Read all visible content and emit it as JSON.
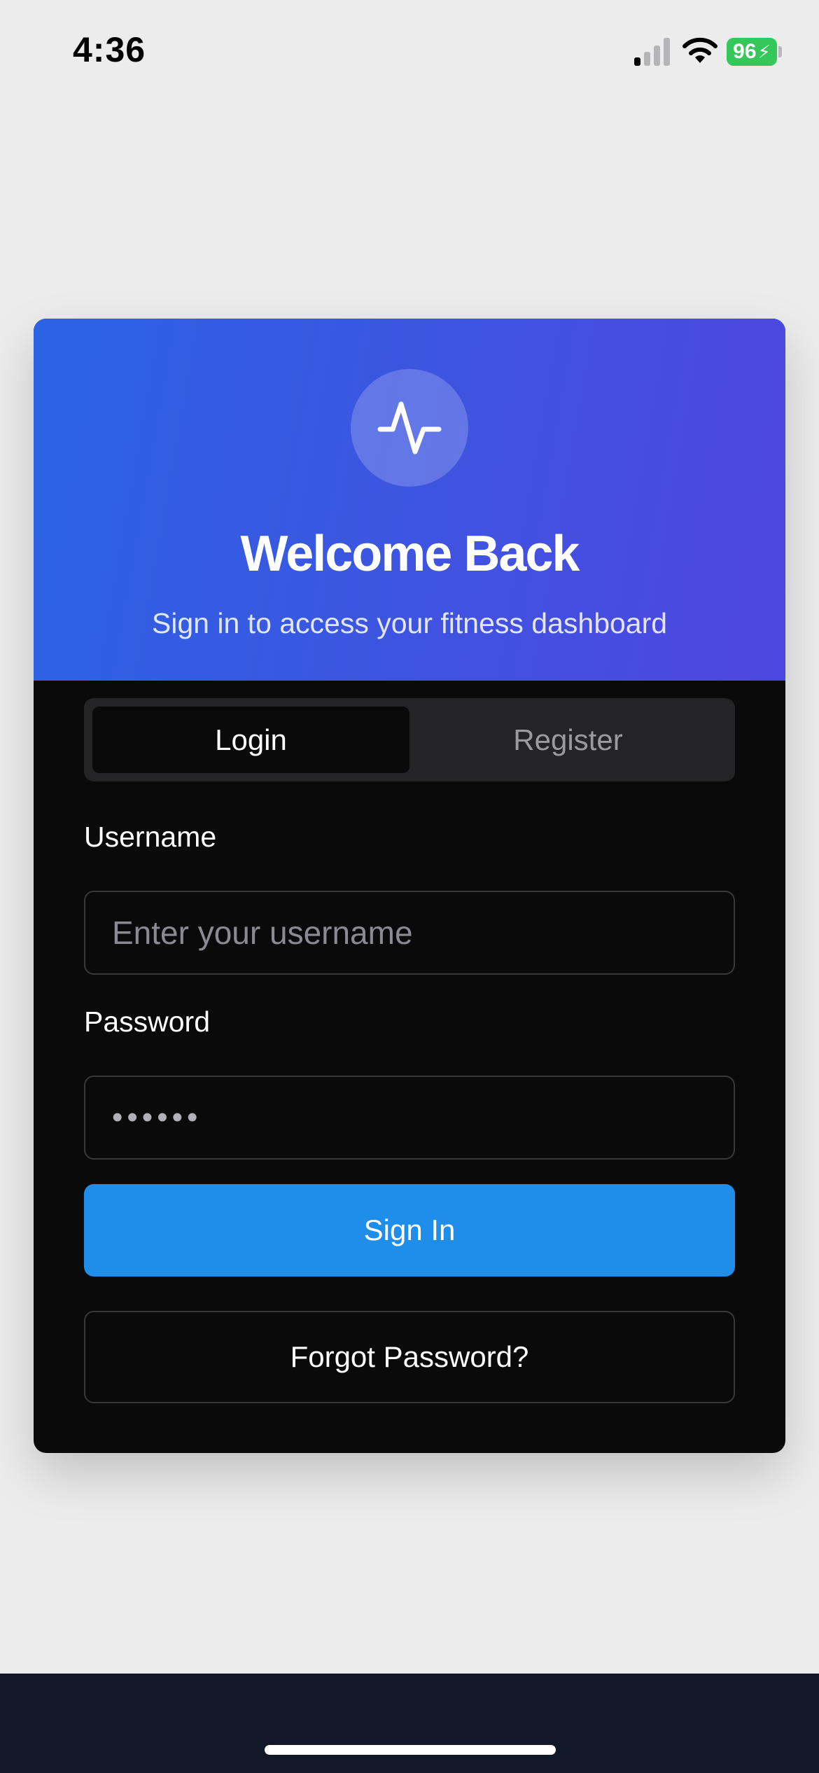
{
  "status_bar": {
    "time": "4:36",
    "battery": "96",
    "icons": [
      "cellular-signal-icon",
      "wifi-icon",
      "battery-charging-icon"
    ]
  },
  "header": {
    "logo_icon": "activity-pulse-icon",
    "title": "Welcome Back",
    "subtitle": "Sign in to access your fitness dashboard"
  },
  "tabs": {
    "login": "Login",
    "register": "Register",
    "active": "login"
  },
  "form": {
    "username_label": "Username",
    "username_placeholder": "Enter your username",
    "password_label": "Password",
    "password_value": "••••••",
    "signin_label": "Sign In",
    "forgot_label": "Forgot Password?"
  },
  "colors": {
    "header_gradient_start": "#2a63e4",
    "header_gradient_end": "#4e46e0",
    "primary_button": "#1f8eea",
    "card_background": "#0a0a0b",
    "page_background": "#ececed",
    "battery": "#34c759"
  }
}
